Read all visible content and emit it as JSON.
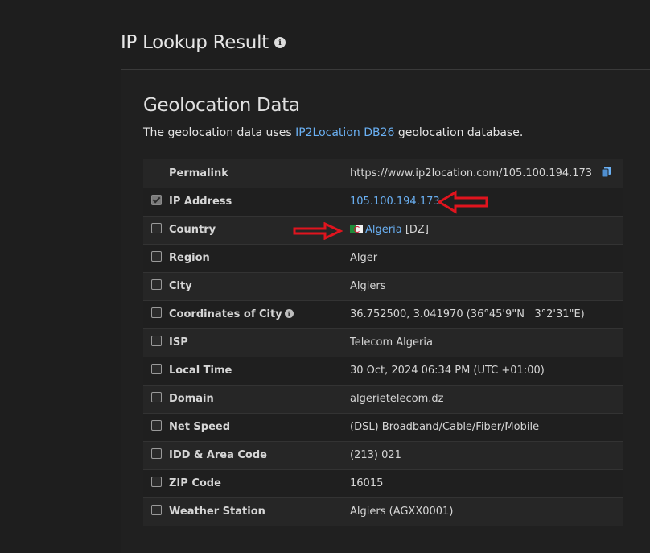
{
  "page": {
    "title": "IP Lookup Result"
  },
  "section": {
    "title": "Geolocation Data",
    "desc_prefix": "The geolocation data uses ",
    "desc_link": "IP2Location DB26",
    "desc_suffix": " geolocation database."
  },
  "rows": [
    {
      "label": "Permalink",
      "value": "https://www.ip2location.com/105.100.194.173",
      "checkbox": false
    },
    {
      "label": "IP Address",
      "value": "105.100.194.173",
      "checkbox": true,
      "checked": true
    },
    {
      "label": "Country",
      "country_name": "Algeria",
      "country_code": "[DZ]",
      "checkbox": true,
      "checked": false
    },
    {
      "label": "Region",
      "value": "Alger",
      "checkbox": true,
      "checked": false
    },
    {
      "label": "City",
      "value": "Algiers",
      "checkbox": true,
      "checked": false
    },
    {
      "label": "Coordinates of City",
      "value": "36.752500, 3.041970 (36°45'9\"N   3°2'31\"E)",
      "checkbox": true,
      "checked": false
    },
    {
      "label": "ISP",
      "value": "Telecom Algeria",
      "checkbox": true,
      "checked": false
    },
    {
      "label": "Local Time",
      "value": "30 Oct, 2024 06:34 PM (UTC +01:00)",
      "checkbox": true,
      "checked": false
    },
    {
      "label": "Domain",
      "value": "algerietelecom.dz",
      "checkbox": true,
      "checked": false
    },
    {
      "label": "Net Speed",
      "value": "(DSL) Broadband/Cable/Fiber/Mobile",
      "checkbox": true,
      "checked": false
    },
    {
      "label": "IDD & Area Code",
      "value": "(213) 021",
      "checkbox": true,
      "checked": false
    },
    {
      "label": "ZIP Code",
      "value": "16015",
      "checkbox": true,
      "checked": false
    },
    {
      "label": "Weather Station",
      "value": "Algiers (AGXX0001)",
      "checkbox": true,
      "checked": false
    }
  ],
  "icons": {
    "title_info": "info-icon",
    "copy": "copy-icon",
    "flag": "algeria-flag-icon",
    "coord_info": "info-icon",
    "annotation": "red-arrow-icon"
  },
  "colors": {
    "link": "#6ab0f3",
    "arrow": "#e0141e",
    "background": "#1e1e1e"
  }
}
